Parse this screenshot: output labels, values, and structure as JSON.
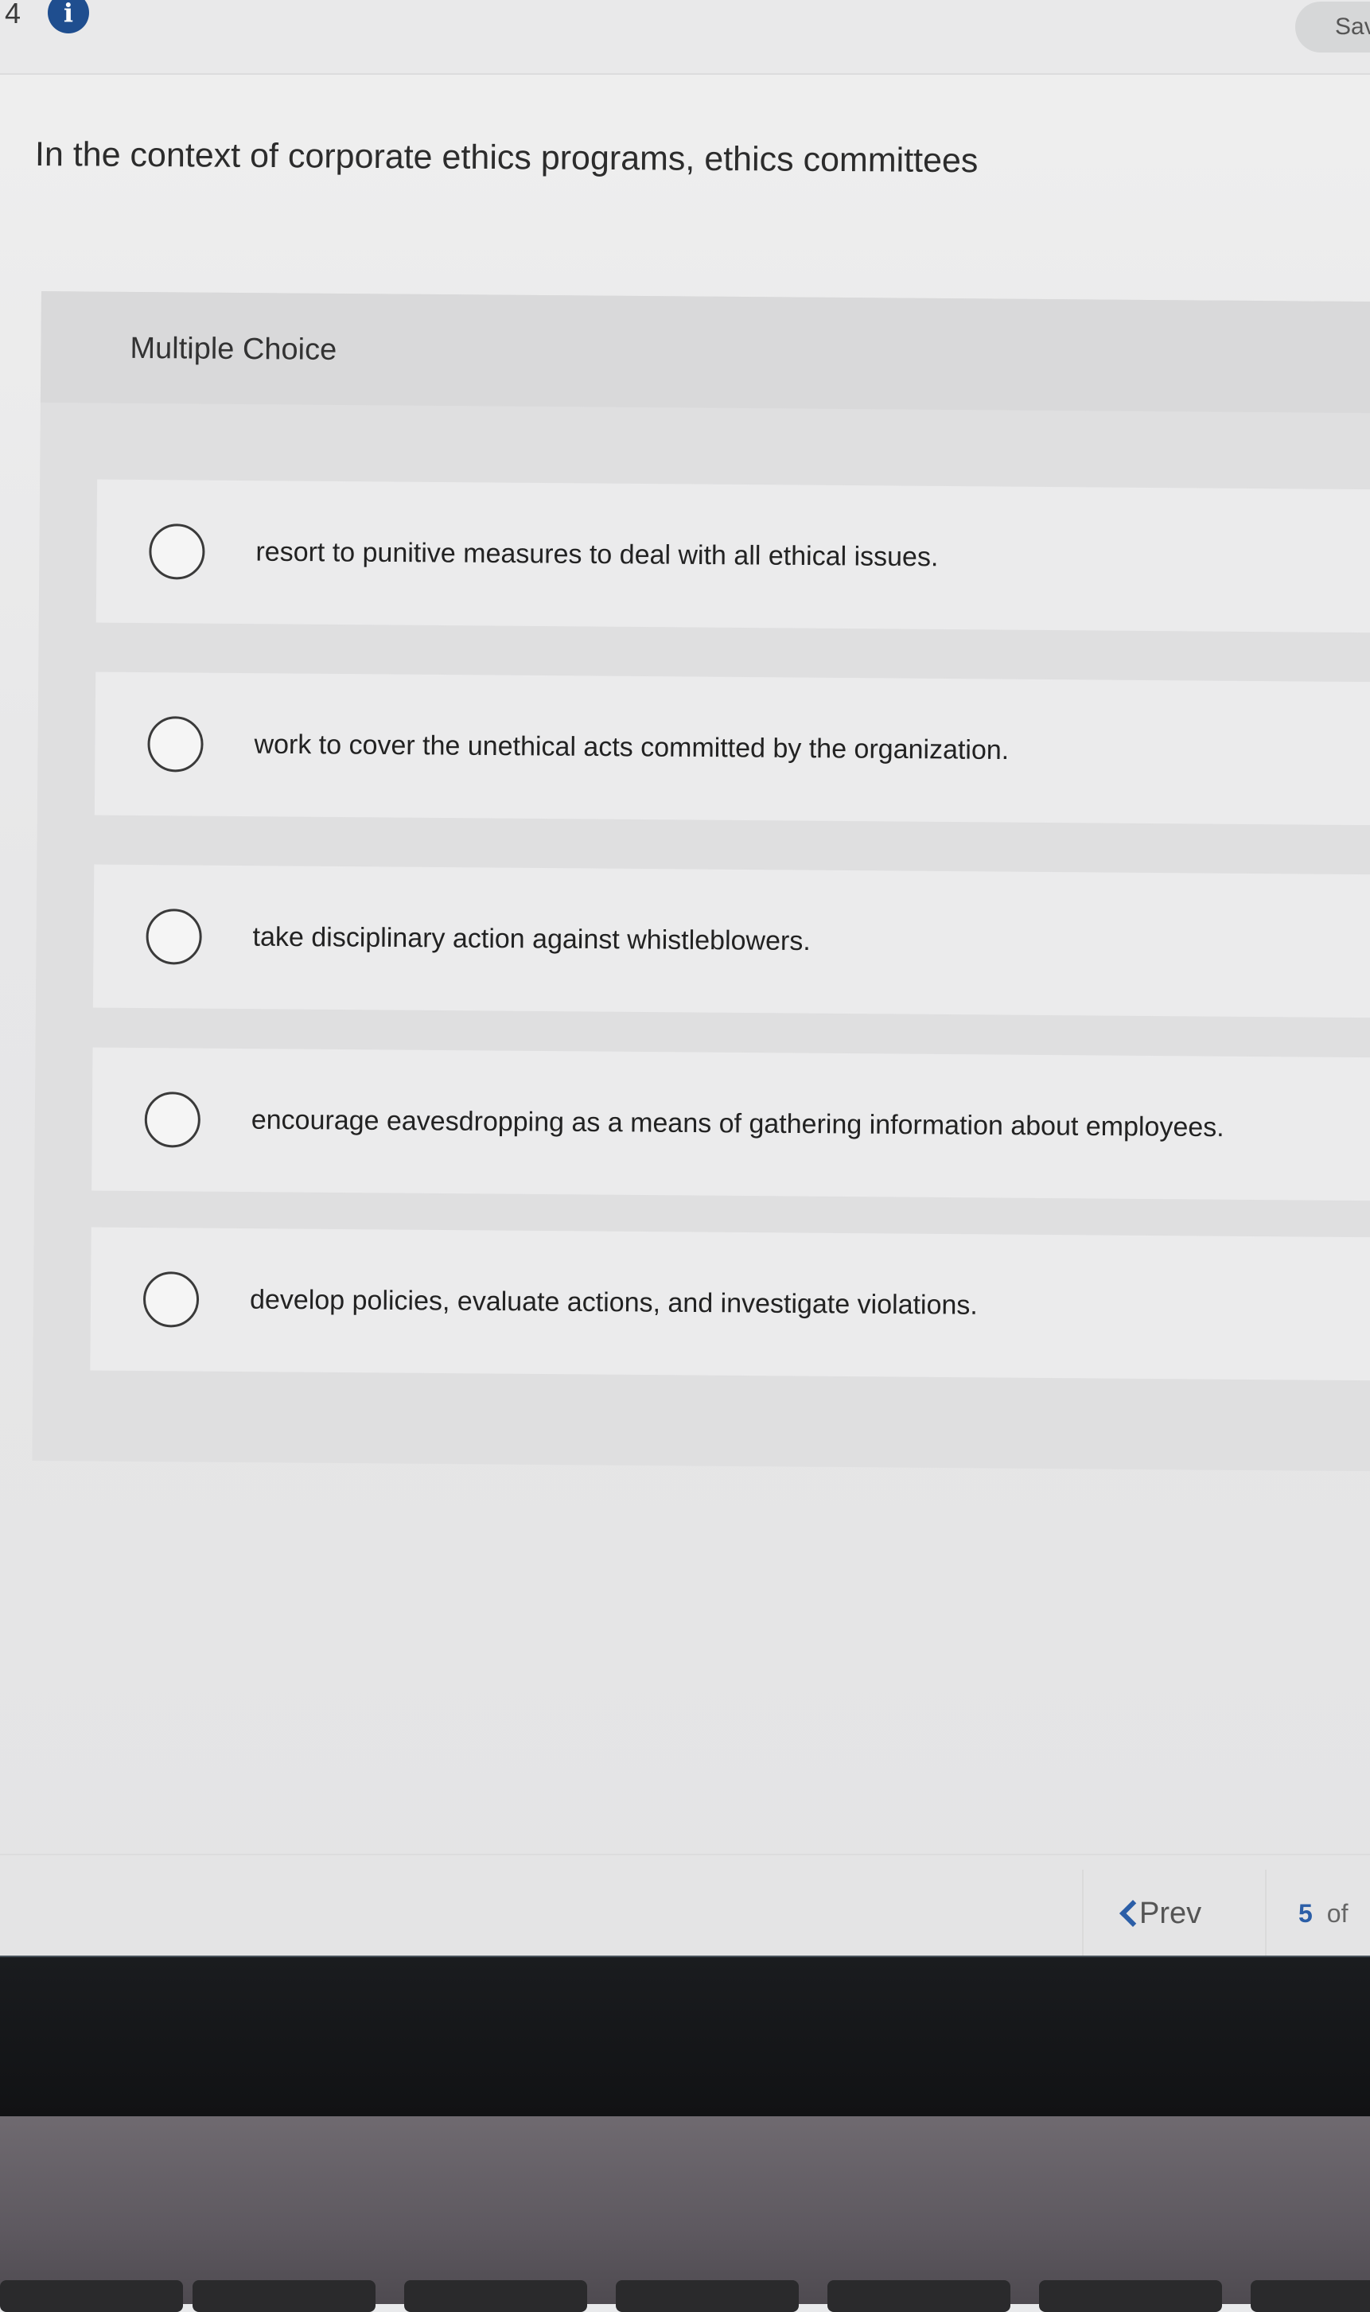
{
  "header": {
    "question_number": "4",
    "info_icon": "info-icon",
    "save_label": "Sav"
  },
  "question": {
    "prompt": "In the context of corporate ethics programs, ethics committees",
    "type_label": "Multiple Choice",
    "options": [
      "resort to punitive measures to deal with all ethical issues.",
      "work to cover the unethical acts committed by the organization.",
      "take disciplinary action against whistleblowers.",
      "encourage eavesdropping as a means of gathering information about employees.",
      "develop policies, evaluate actions, and investigate violations."
    ]
  },
  "footer": {
    "prev_label": "Prev",
    "current_page": "5",
    "of_label": "of"
  },
  "colors": {
    "accent": "#2b5ea7",
    "info_icon_bg": "#1f4e8f"
  }
}
